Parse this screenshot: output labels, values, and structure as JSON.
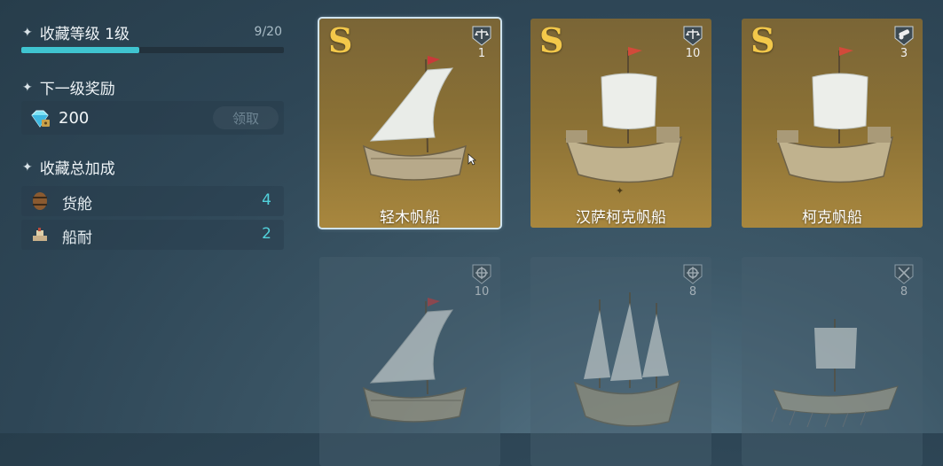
{
  "collection": {
    "level_title": "收藏等级 1级",
    "progress_text": "9/20",
    "progress_fraction": 0.45
  },
  "reward": {
    "title": "下一级奖励",
    "amount": "200",
    "claim_label": "领取"
  },
  "bonus": {
    "title": "收藏总加成",
    "stats": [
      {
        "label": "货舱",
        "value": "4",
        "icon": "barrel-icon"
      },
      {
        "label": "船耐",
        "value": "2",
        "icon": "hull-icon"
      }
    ]
  },
  "cards": [
    {
      "grade": "S",
      "name": "轻木帆船",
      "type_icon": "scale-icon",
      "count": "1",
      "state": "owned-selected"
    },
    {
      "grade": "S",
      "name": "汉萨柯克帆船",
      "type_icon": "scale-icon",
      "count": "10",
      "state": "owned"
    },
    {
      "grade": "S",
      "name": "柯克帆船",
      "type_icon": "cannon-icon",
      "count": "3",
      "state": "owned"
    },
    {
      "grade": "",
      "name": "",
      "type_icon": "helm-icon",
      "count": "10",
      "state": "locked"
    },
    {
      "grade": "",
      "name": "",
      "type_icon": "helm-icon",
      "count": "8",
      "state": "locked"
    },
    {
      "grade": "",
      "name": "",
      "type_icon": "crossed-swords-icon",
      "count": "8",
      "state": "locked"
    }
  ],
  "colors": {
    "accent": "#3fc4d0",
    "stat_value": "#52d2dc",
    "grade": "#f3c84a",
    "card_gold": "#8b7135"
  }
}
